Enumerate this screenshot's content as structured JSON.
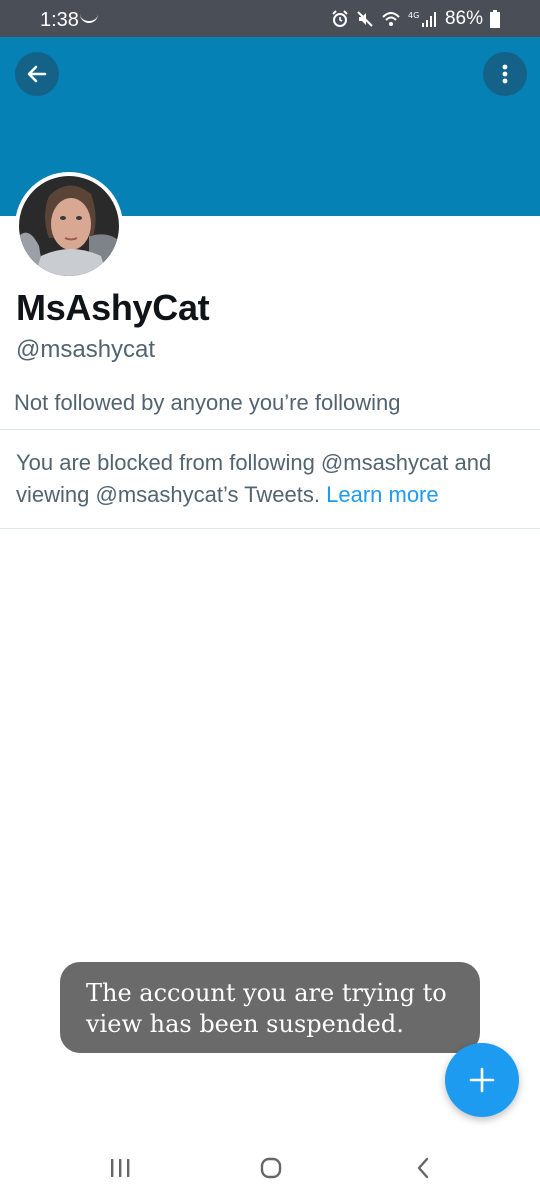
{
  "status_bar": {
    "time": "1:38",
    "battery_percent": "86%",
    "network": "4G"
  },
  "header": {
    "banner_color": "#0581b6",
    "back_icon": "arrow-left-icon",
    "more_icon": "more-vertical-icon"
  },
  "profile": {
    "display_name": "MsAshyCat",
    "handle": "@msashycat",
    "followers_note": "Not followed by anyone you’re following"
  },
  "blocked_notice": {
    "text": "You are blocked from following @msashycat and viewing @msashycat’s Tweets.",
    "link_label": "Learn more"
  },
  "toast": {
    "message": "The account you are trying to view has been suspended."
  },
  "fab": {
    "icon": "plus-icon",
    "color": "#1d9bf0"
  },
  "navbar": {
    "recents_icon": "recents-icon",
    "home_icon": "home-icon",
    "back_icon": "back-chevron-icon"
  }
}
